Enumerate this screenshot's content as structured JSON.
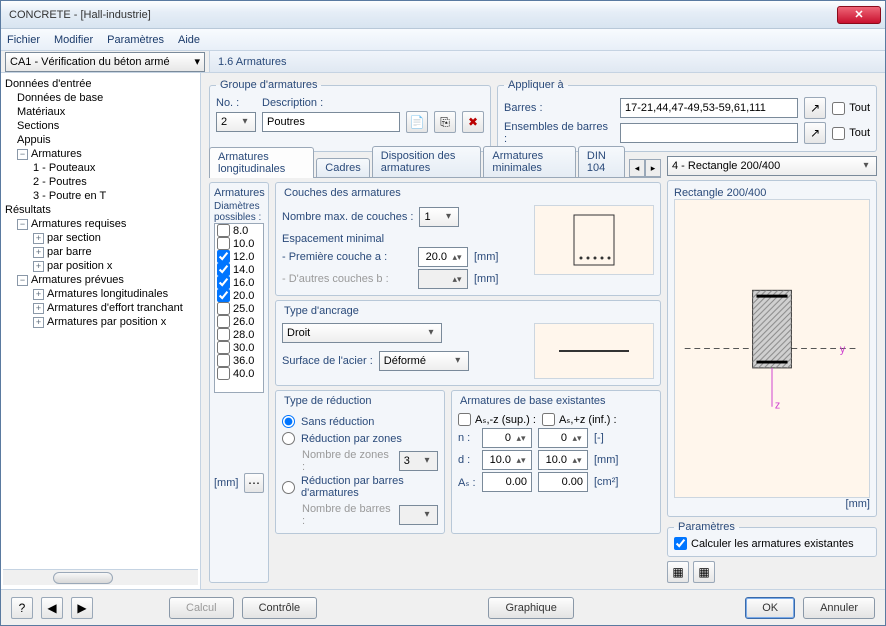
{
  "window": {
    "title": "CONCRETE - [Hall-industrie]"
  },
  "menu": {
    "file": "Fichier",
    "edit": "Modifier",
    "params": "Paramètres",
    "help": "Aide"
  },
  "top_combo": "CA1 - Vérification du béton armé",
  "section_header": "1.6 Armatures",
  "tree": {
    "donnees": "Données d'entrée",
    "base": "Données de base",
    "materiaux": "Matériaux",
    "sections": "Sections",
    "appuis": "Appuis",
    "armatures": "Armatures",
    "arm1": "1 - Pouteaux",
    "arm2": "2 - Poutres",
    "arm3": "3 - Poutre en T",
    "resultats": "Résultats",
    "req": "Armatures requises",
    "req1": "par section",
    "req2": "par barre",
    "req3": "par position x",
    "prev": "Armatures prévues",
    "prev1": "Armatures longitudinales",
    "prev2": "Armatures d'effort tranchant",
    "prev3": "Armatures par position x"
  },
  "group": {
    "legend": "Groupe d'armatures",
    "no_label": "No. :",
    "no_value": "2",
    "desc_label": "Description :",
    "desc_value": "Poutres"
  },
  "apply": {
    "legend": "Appliquer à",
    "barres_label": "Barres :",
    "barres_value": "17-21,44,47-49,53-59,61,111",
    "ens_label": "Ensembles de barres :",
    "ens_value": "",
    "tout": "Tout"
  },
  "tabs": {
    "t1": "Armatures longitudinales",
    "t2": "Cadres",
    "t3": "Disposition des armatures",
    "t4": "Armatures minimales",
    "t5": "DIN 104"
  },
  "section_combo": "4 - Rectangle 200/400",
  "arm_col": {
    "title": "Armatures",
    "sub": "Diamètres possibles :",
    "items": [
      "8.0",
      "10.0",
      "12.0",
      "14.0",
      "16.0",
      "20.0",
      "25.0",
      "26.0",
      "28.0",
      "30.0",
      "36.0",
      "40.0"
    ],
    "checked": [
      false,
      false,
      true,
      true,
      true,
      true,
      false,
      false,
      false,
      false,
      false,
      false
    ],
    "unit": "[mm]"
  },
  "couches": {
    "title": "Couches des armatures",
    "max_label": "Nombre max. de couches :",
    "max_value": "1",
    "esp_title": "Espacement minimal",
    "row_a_label": "- Première couche   a :",
    "row_a_value": "20.0",
    "row_b_label": "- D'autres couches   b :",
    "row_b_value": "",
    "unit": "[mm]"
  },
  "ancrage": {
    "title": "Type d'ancrage",
    "type_value": "Droit",
    "surf_label": "Surface de l'acier :",
    "surf_value": "Déformé"
  },
  "reduction": {
    "title": "Type de réduction",
    "r1": "Sans réduction",
    "r2": "Réduction par zones",
    "r2_sub": "Nombre de zones :",
    "r2_val": "3",
    "r3": "Réduction par barres d'armatures",
    "r3_sub": "Nombre de barres :"
  },
  "existantes": {
    "title": "Armatures de base existantes",
    "as_sup": "Aₛ,-z (sup.) :",
    "as_inf": "Aₛ,+z (inf.) :",
    "n_label": "n :",
    "n_v1": "0",
    "n_v2": "0",
    "n_unit": "[-]",
    "d_label": "d :",
    "d_v1": "10.0",
    "d_v2": "10.0",
    "d_unit": "[mm]",
    "as_label": "Aₛ :",
    "as_v1": "0.00",
    "as_v2": "0.00",
    "as_unit": "[cm²]"
  },
  "preview": {
    "title": "Rectangle 200/400",
    "unit": "[mm]"
  },
  "params": {
    "legend": "Paramètres",
    "chk": "Calculer les armatures existantes"
  },
  "footer": {
    "calcul": "Calcul",
    "controle": "Contrôle",
    "graphique": "Graphique",
    "ok": "OK",
    "annuler": "Annuler"
  }
}
